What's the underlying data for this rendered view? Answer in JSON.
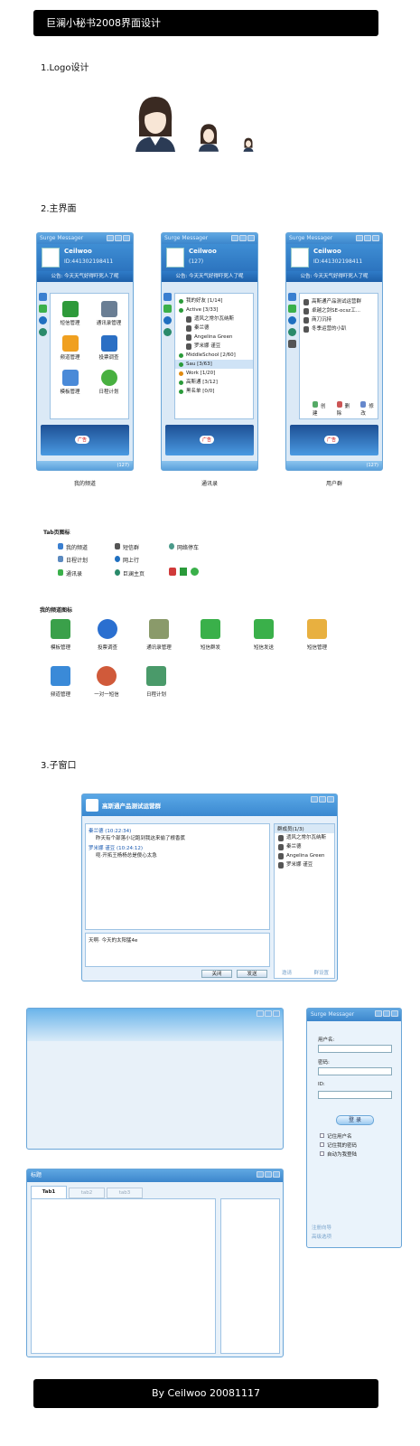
{
  "header": {
    "title": "巨澜小秘书2008界面设计"
  },
  "sections": {
    "logo": "1.Logo设计",
    "main": "2.主界面",
    "sub": "3.子窗口"
  },
  "main_windows": {
    "app_title": "Surge Messager",
    "username": "Ceilwoo",
    "user_id": "ID:441302198411",
    "notice": "公告: 今天天气好得吓死人了呢",
    "status_count": "(127)",
    "captions": [
      "我的频道",
      "通讯录",
      "用户群"
    ]
  },
  "channel_items": [
    "短信管理",
    "通讯录管理",
    "频道管理",
    "投票调查",
    "模板管理",
    "日程计划"
  ],
  "contacts": [
    {
      "label": "我的好友 [1/14]",
      "type": "group",
      "color": "#2a9a3a"
    },
    {
      "label": "Active [3/33]",
      "type": "group",
      "color": "#2a9a3a"
    },
    {
      "label": "遗风之常尔瓦纳斯",
      "type": "user"
    },
    {
      "label": "秦兰德",
      "type": "user"
    },
    {
      "label": "Angelina Green",
      "type": "user"
    },
    {
      "label": "罗米娜 谨豆",
      "type": "user"
    },
    {
      "label": "MiddleSchool [2/60]",
      "type": "group",
      "color": "#2a9a3a"
    },
    {
      "label": "Sau [3/63]",
      "type": "group",
      "color": "#2a9a3a"
    },
    {
      "label": "Work [1/20]",
      "type": "group",
      "color": "#e08a10"
    },
    {
      "label": "高斯通 [3/12]",
      "type": "group",
      "color": "#2a9a3a"
    },
    {
      "label": "黑名单 [0/0]",
      "type": "group",
      "color": "#2a9a3a"
    }
  ],
  "groups": [
    "高斯通产品测试运营群",
    "卓越之剑SE-ocsz工...",
    "商刀沉持",
    "冬季运营的小趴"
  ],
  "group_actions": [
    "创建",
    "删除",
    "修改"
  ],
  "tab_icons_title": "Tab页图标",
  "tab_icons": [
    "我的频道",
    "短信群",
    "网络停车",
    "日程计划",
    "网上行",
    "通讯录",
    "巨澜主页"
  ],
  "channel_icons_title": "我的频道图标",
  "channel_icons": [
    "模板管理",
    "投票调查",
    "通讯录管理",
    "短信群发",
    "短信发送",
    "短信管理",
    "频道管理",
    "一对一短信",
    "日程计划"
  ],
  "chat": {
    "title": "高斯通产品测试运营群",
    "msg1_name": "秦兰德",
    "msg1_time": "(10:22:34)",
    "msg1_text": "昨天有个部落小记跑到我这来偷了根香蕉",
    "msg2_name": "罗米娜 谨豆",
    "msg2_time": "(10:24:12)",
    "msg2_text": "呃·开拓王杨杨总是傻心太急",
    "input": "天啊· 今天的太阳猛4e",
    "close": "关闭",
    "send": "发送",
    "members_title": "群成员(1/3)",
    "members": [
      "遗风之常尔瓦纳斯",
      "秦兰德",
      "Angelina Green",
      "罗米娜 谨豆"
    ],
    "member_links": [
      "邀请",
      "群设置"
    ]
  },
  "tabs_window": {
    "title": "标题",
    "tabs": [
      "Tab1",
      "tab2",
      "tab3"
    ]
  },
  "login": {
    "title": "Surge Messager",
    "username_label": "用户名:",
    "password_label": "密码:",
    "id_label": "ID:",
    "login_button": "登 录",
    "options": [
      "记住用户名",
      "记住我的密码",
      "自动为我登陆"
    ],
    "links": [
      "注册向导",
      "高级选项"
    ]
  },
  "footer": {
    "text": "By Ceilwoo 20081117"
  }
}
